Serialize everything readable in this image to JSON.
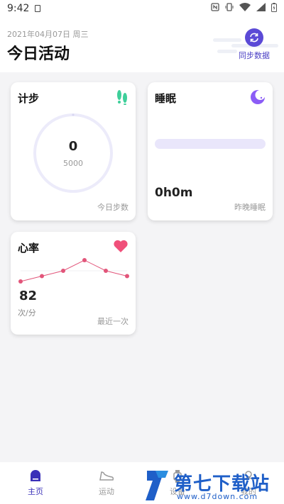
{
  "status_bar": {
    "time": "9:42"
  },
  "header": {
    "date": "2021年04月07日 周三",
    "title": "今日活动",
    "sync_label": "同步数据"
  },
  "steps_card": {
    "title": "计步",
    "value": "0",
    "goal": "5000",
    "footer": "今日步数",
    "icon": "footprints-icon",
    "progress": 0,
    "icon_color": "#3ecf9a",
    "ring_color": "#ecebfa"
  },
  "sleep_card": {
    "title": "睡眠",
    "value": "0h0m",
    "footer": "昨晚睡眠",
    "icon": "moon-icon",
    "icon_color": "#8b5cf6",
    "bar_color": "#e9e6fb"
  },
  "heart_card": {
    "title": "心率",
    "value": "82",
    "unit": "次/分",
    "footer": "最近一次",
    "icon": "heart-icon",
    "icon_color": "#f0507a"
  },
  "chart_data": {
    "type": "line",
    "series": [
      {
        "values": [
          3,
          4,
          5,
          7,
          5,
          4
        ]
      }
    ],
    "color": "#e2557a",
    "grid": false
  },
  "bottom_nav": {
    "items": [
      {
        "label": "主页",
        "icon": "home-icon",
        "active": true
      },
      {
        "label": "运动",
        "icon": "shoe-icon",
        "active": false
      },
      {
        "label": "设备",
        "icon": "watch-icon",
        "active": false
      },
      {
        "label": "我的",
        "icon": "profile-icon",
        "active": false
      }
    ]
  },
  "watermark": {
    "brand": "第七下载站",
    "url": "www.d7down.com"
  },
  "colors": {
    "accent": "#5b4ad6",
    "background": "#f4f4f6"
  }
}
